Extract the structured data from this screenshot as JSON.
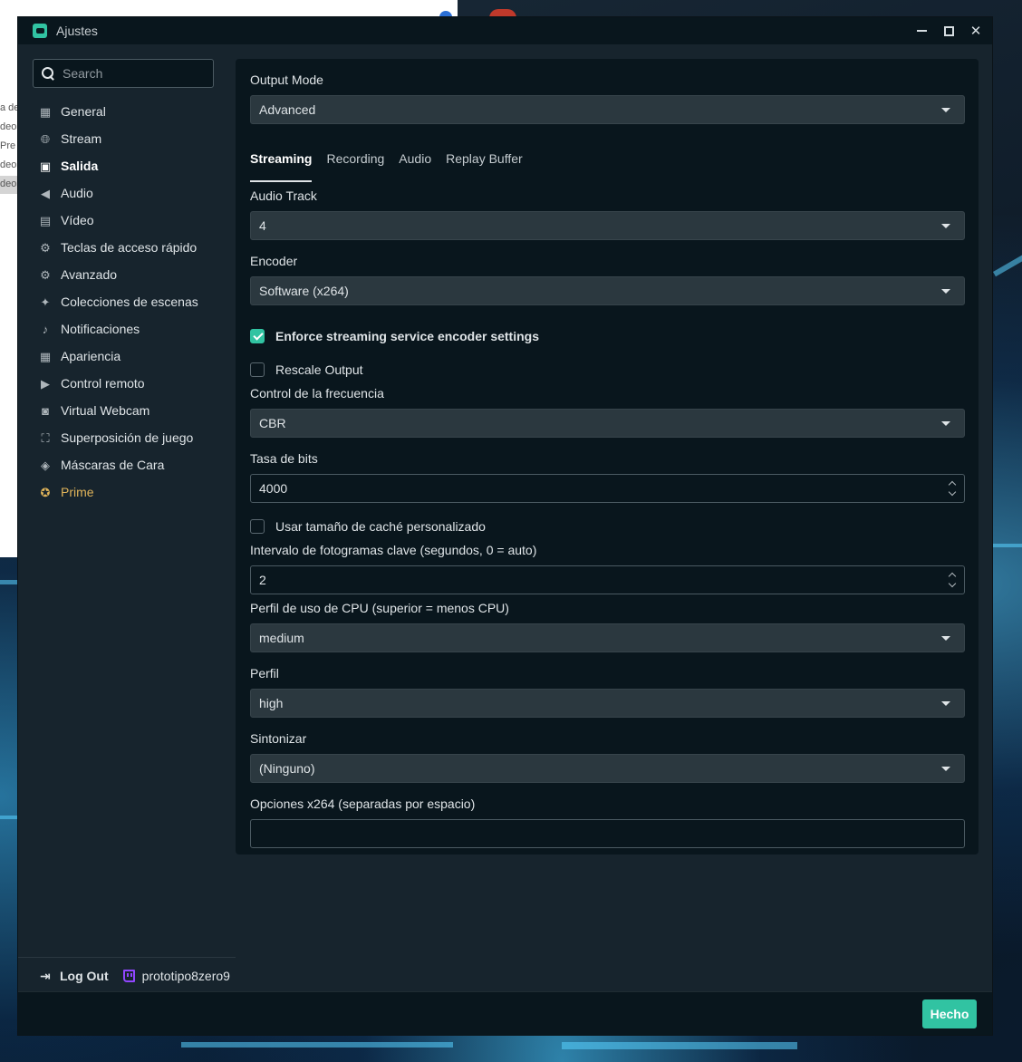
{
  "window": {
    "title": "Ajustes"
  },
  "background_app": {
    "lines": [
      "a de",
      "deo",
      "Pre",
      "deo",
      "deo"
    ]
  },
  "search": {
    "placeholder": "Search"
  },
  "sidebar": {
    "items": [
      {
        "label": "General",
        "icon": "grid-icon"
      },
      {
        "label": "Stream",
        "icon": "globe-icon"
      },
      {
        "label": "Salida",
        "icon": "chip-icon",
        "active": true
      },
      {
        "label": "Audio",
        "icon": "speaker-icon"
      },
      {
        "label": "Vídeo",
        "icon": "film-icon"
      },
      {
        "label": "Teclas de acceso rápido",
        "icon": "gear-icon"
      },
      {
        "label": "Avanzado",
        "icon": "gears-icon"
      },
      {
        "label": "Colecciones de escenas",
        "icon": "magic-wand-icon"
      },
      {
        "label": "Notificaciones",
        "icon": "bell-icon"
      },
      {
        "label": "Apariencia",
        "icon": "grid-icon"
      },
      {
        "label": "Control remoto",
        "icon": "play-circle-icon"
      },
      {
        "label": "Virtual Webcam",
        "icon": "camera-icon"
      },
      {
        "label": "Superposición de juego",
        "icon": "expand-icon"
      },
      {
        "label": "Máscaras de Cara",
        "icon": "mask-icon"
      },
      {
        "label": "Prime",
        "icon": "star-badge-icon",
        "color": "#e0b45a"
      }
    ],
    "footer": {
      "logout_label": "Log Out",
      "username": "prototipo8zero9"
    }
  },
  "content": {
    "output_mode": {
      "label": "Output Mode",
      "value": "Advanced"
    },
    "tabs": [
      "Streaming",
      "Recording",
      "Audio",
      "Replay Buffer"
    ],
    "active_tab": "Streaming",
    "audio_track": {
      "label": "Audio Track",
      "value": "4"
    },
    "encoder": {
      "label": "Encoder",
      "value": "Software (x264)"
    },
    "enforce": {
      "label": "Enforce streaming service encoder settings",
      "checked": true
    },
    "rescale": {
      "label": "Rescale Output",
      "checked": false
    },
    "rate_control": {
      "label": "Control de la frecuencia",
      "value": "CBR"
    },
    "bitrate": {
      "label": "Tasa de bits",
      "value": "4000"
    },
    "custom_buffer": {
      "label": "Usar tamaño de caché personalizado",
      "checked": false
    },
    "keyframe": {
      "label": "Intervalo de fotogramas clave (segundos, 0 = auto)",
      "value": "2"
    },
    "cpu_preset": {
      "label": "Perfil de uso de CPU (superior = menos CPU)",
      "value": "medium"
    },
    "profile": {
      "label": "Perfil",
      "value": "high"
    },
    "tune": {
      "label": "Sintonizar",
      "value": "(Ninguno)"
    },
    "x264_options": {
      "label": "Opciones x264 (separadas por espacio)",
      "value": ""
    }
  },
  "footer": {
    "done_label": "Hecho"
  },
  "colors": {
    "accent": "#31c3a2",
    "prime": "#e0b45a",
    "twitch": "#9146ff"
  }
}
